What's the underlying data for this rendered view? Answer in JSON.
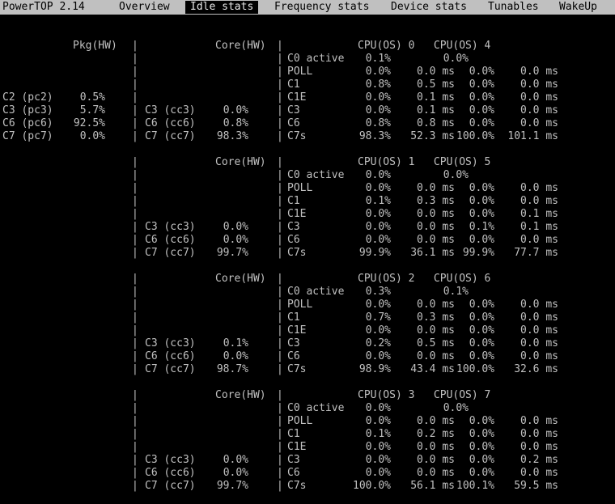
{
  "tabs": [
    {
      "label": "PowerTOP 2.14",
      "active": false
    },
    {
      "label": "Overview",
      "active": false
    },
    {
      "label": "Idle stats",
      "active": true
    },
    {
      "label": "Frequency stats",
      "active": false
    },
    {
      "label": "Device stats",
      "active": false
    },
    {
      "label": "Tunables",
      "active": false
    },
    {
      "label": "WakeUp",
      "active": false
    }
  ],
  "package": {
    "header": "Pkg(HW)",
    "states": [
      {
        "name": "C2 (pc2)",
        "value": "0.5%"
      },
      {
        "name": "C3 (pc3)",
        "value": "5.7%"
      },
      {
        "name": "C6 (pc6)",
        "value": "92.5%"
      },
      {
        "name": "C7 (pc7)",
        "value": "0.0%"
      }
    ]
  },
  "core_header": "Core(HW)",
  "blocks": [
    {
      "cpu_header": "CPU(OS) 0   CPU(OS) 4",
      "core_states": [
        {
          "name": "C3 (cc3)",
          "value": "0.0%"
        },
        {
          "name": "C6 (cc6)",
          "value": "0.8%"
        },
        {
          "name": "C7 (cc7)",
          "value": "98.3%"
        }
      ],
      "rows": [
        {
          "state": "C0 active",
          "a": "0.1%",
          "at": "",
          "b": "0.0%",
          "bt": ""
        },
        {
          "state": "POLL",
          "a": "0.0%",
          "at": "0.0 ms",
          "b": "0.0%",
          "bt": "0.0 ms"
        },
        {
          "state": "C1",
          "a": "0.8%",
          "at": "0.5 ms",
          "b": "0.0%",
          "bt": "0.0 ms"
        },
        {
          "state": "C1E",
          "a": "0.0%",
          "at": "0.1 ms",
          "b": "0.0%",
          "bt": "0.0 ms"
        },
        {
          "state": "C3",
          "a": "0.0%",
          "at": "0.1 ms",
          "b": "0.0%",
          "bt": "0.0 ms"
        },
        {
          "state": "C6",
          "a": "0.8%",
          "at": "0.8 ms",
          "b": "0.0%",
          "bt": "0.0 ms"
        },
        {
          "state": "C7s",
          "a": "98.3%",
          "at": "52.3 ms",
          "b": "100.0%",
          "bt": "101.1 ms"
        }
      ]
    },
    {
      "cpu_header": "CPU(OS) 1   CPU(OS) 5",
      "core_states": [
        {
          "name": "C3 (cc3)",
          "value": "0.0%"
        },
        {
          "name": "C6 (cc6)",
          "value": "0.0%"
        },
        {
          "name": "C7 (cc7)",
          "value": "99.7%"
        }
      ],
      "rows": [
        {
          "state": "C0 active",
          "a": "0.0%",
          "at": "",
          "b": "0.0%",
          "bt": ""
        },
        {
          "state": "POLL",
          "a": "0.0%",
          "at": "0.0 ms",
          "b": "0.0%",
          "bt": "0.0 ms"
        },
        {
          "state": "C1",
          "a": "0.1%",
          "at": "0.3 ms",
          "b": "0.0%",
          "bt": "0.0 ms"
        },
        {
          "state": "C1E",
          "a": "0.0%",
          "at": "0.0 ms",
          "b": "0.0%",
          "bt": "0.1 ms"
        },
        {
          "state": "C3",
          "a": "0.0%",
          "at": "0.0 ms",
          "b": "0.1%",
          "bt": "0.1 ms"
        },
        {
          "state": "C6",
          "a": "0.0%",
          "at": "0.0 ms",
          "b": "0.0%",
          "bt": "0.0 ms"
        },
        {
          "state": "C7s",
          "a": "99.9%",
          "at": "36.1 ms",
          "b": "99.9%",
          "bt": "77.7 ms"
        }
      ]
    },
    {
      "cpu_header": "CPU(OS) 2   CPU(OS) 6",
      "core_states": [
        {
          "name": "C3 (cc3)",
          "value": "0.1%"
        },
        {
          "name": "C6 (cc6)",
          "value": "0.0%"
        },
        {
          "name": "C7 (cc7)",
          "value": "98.7%"
        }
      ],
      "rows": [
        {
          "state": "C0 active",
          "a": "0.3%",
          "at": "",
          "b": "0.1%",
          "bt": ""
        },
        {
          "state": "POLL",
          "a": "0.0%",
          "at": "0.0 ms",
          "b": "0.0%",
          "bt": "0.0 ms"
        },
        {
          "state": "C1",
          "a": "0.7%",
          "at": "0.3 ms",
          "b": "0.0%",
          "bt": "0.0 ms"
        },
        {
          "state": "C1E",
          "a": "0.0%",
          "at": "0.0 ms",
          "b": "0.0%",
          "bt": "0.0 ms"
        },
        {
          "state": "C3",
          "a": "0.2%",
          "at": "0.5 ms",
          "b": "0.0%",
          "bt": "0.0 ms"
        },
        {
          "state": "C6",
          "a": "0.0%",
          "at": "0.0 ms",
          "b": "0.0%",
          "bt": "0.0 ms"
        },
        {
          "state": "C7s",
          "a": "98.9%",
          "at": "43.4 ms",
          "b": "100.0%",
          "bt": "32.6 ms"
        }
      ]
    },
    {
      "cpu_header": "CPU(OS) 3   CPU(OS) 7",
      "core_states": [
        {
          "name": "C3 (cc3)",
          "value": "0.0%"
        },
        {
          "name": "C6 (cc6)",
          "value": "0.0%"
        },
        {
          "name": "C7 (cc7)",
          "value": "99.7%"
        }
      ],
      "rows": [
        {
          "state": "C0 active",
          "a": "0.0%",
          "at": "",
          "b": "0.0%",
          "bt": ""
        },
        {
          "state": "POLL",
          "a": "0.0%",
          "at": "0.0 ms",
          "b": "0.0%",
          "bt": "0.0 ms"
        },
        {
          "state": "C1",
          "a": "0.1%",
          "at": "0.2 ms",
          "b": "0.0%",
          "bt": "0.0 ms"
        },
        {
          "state": "C1E",
          "a": "0.0%",
          "at": "0.0 ms",
          "b": "0.0%",
          "bt": "0.0 ms"
        },
        {
          "state": "C3",
          "a": "0.0%",
          "at": "0.0 ms",
          "b": "0.0%",
          "bt": "0.2 ms"
        },
        {
          "state": "C6",
          "a": "0.0%",
          "at": "0.0 ms",
          "b": "0.0%",
          "bt": "0.0 ms"
        },
        {
          "state": "C7s",
          "a": "100.0%",
          "at": "56.1 ms",
          "b": "100.1%",
          "bt": "59.5 ms"
        }
      ]
    }
  ]
}
